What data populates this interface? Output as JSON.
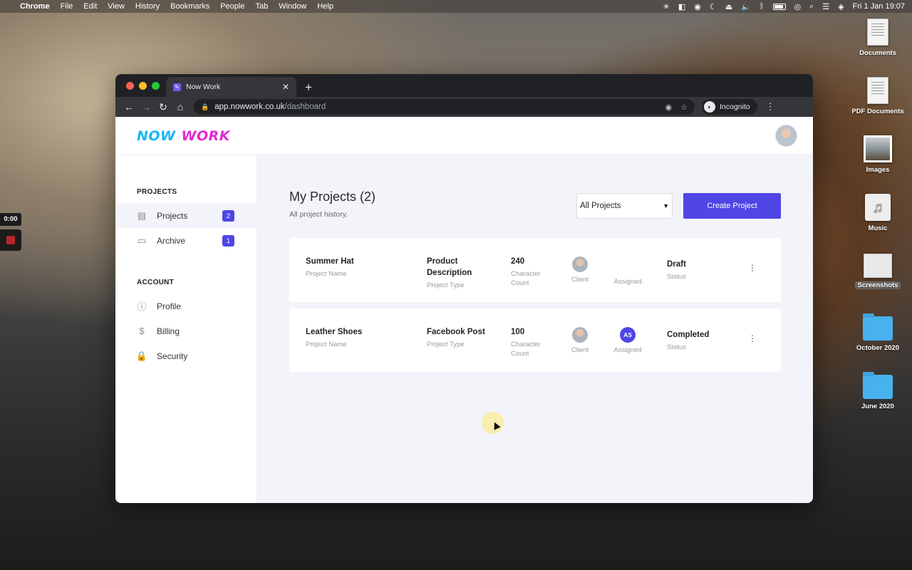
{
  "menubar": {
    "app": "Chrome",
    "items": [
      "File",
      "Edit",
      "View",
      "History",
      "Bookmarks",
      "People",
      "Tab",
      "Window",
      "Help"
    ],
    "clock": "Fri 1 Jan  19:07"
  },
  "desktop": {
    "icons": [
      {
        "label": "Documents",
        "icon": "document-icon"
      },
      {
        "label": "PDF Documents",
        "icon": "document-icon"
      },
      {
        "label": "Images",
        "icon": "image-icon"
      },
      {
        "label": "Music",
        "icon": "music-icon"
      },
      {
        "label": "Screenshots",
        "icon": "screenshot-icon"
      },
      {
        "label": "October 2020",
        "icon": "folder-icon"
      },
      {
        "label": "June 2020",
        "icon": "folder-icon"
      }
    ],
    "recorder_time": "0:00"
  },
  "browser": {
    "tab_title": "Now Work",
    "url_host": "app.nowwork.co.uk",
    "url_path": "/dashboard",
    "profile_label": "Incognito"
  },
  "app": {
    "logo_now": "NOW",
    "logo_work": "WORK",
    "sidebar": {
      "projects_heading": "PROJECTS",
      "account_heading": "ACCOUNT",
      "items": [
        {
          "label": "Projects",
          "badge": "2"
        },
        {
          "label": "Archive",
          "badge": "1"
        },
        {
          "label": "Profile"
        },
        {
          "label": "Billing"
        },
        {
          "label": "Security"
        }
      ]
    },
    "page": {
      "title": "My Projects (2)",
      "subtitle": "All project history.",
      "filter_value": "All Projects",
      "create_label": "Create Project"
    },
    "labels": {
      "project_name": "Project Name",
      "project_type": "Project Type",
      "character_count": "Character Count",
      "client": "Client",
      "assigned": "Assigned",
      "status": "Status"
    },
    "projects": [
      {
        "name": "Summer Hat",
        "type": "Product Description",
        "count": "240",
        "assigned_initials": "",
        "status": "Draft"
      },
      {
        "name": "Leather Shoes",
        "type": "Facebook Post",
        "count": "100",
        "assigned_initials": "AS",
        "status": "Completed"
      }
    ]
  },
  "colors": {
    "accent": "#4f46e5",
    "logo_now": "#18b7f0",
    "logo_work": "#e02ad4",
    "app_bg": "#f3f3fa"
  }
}
